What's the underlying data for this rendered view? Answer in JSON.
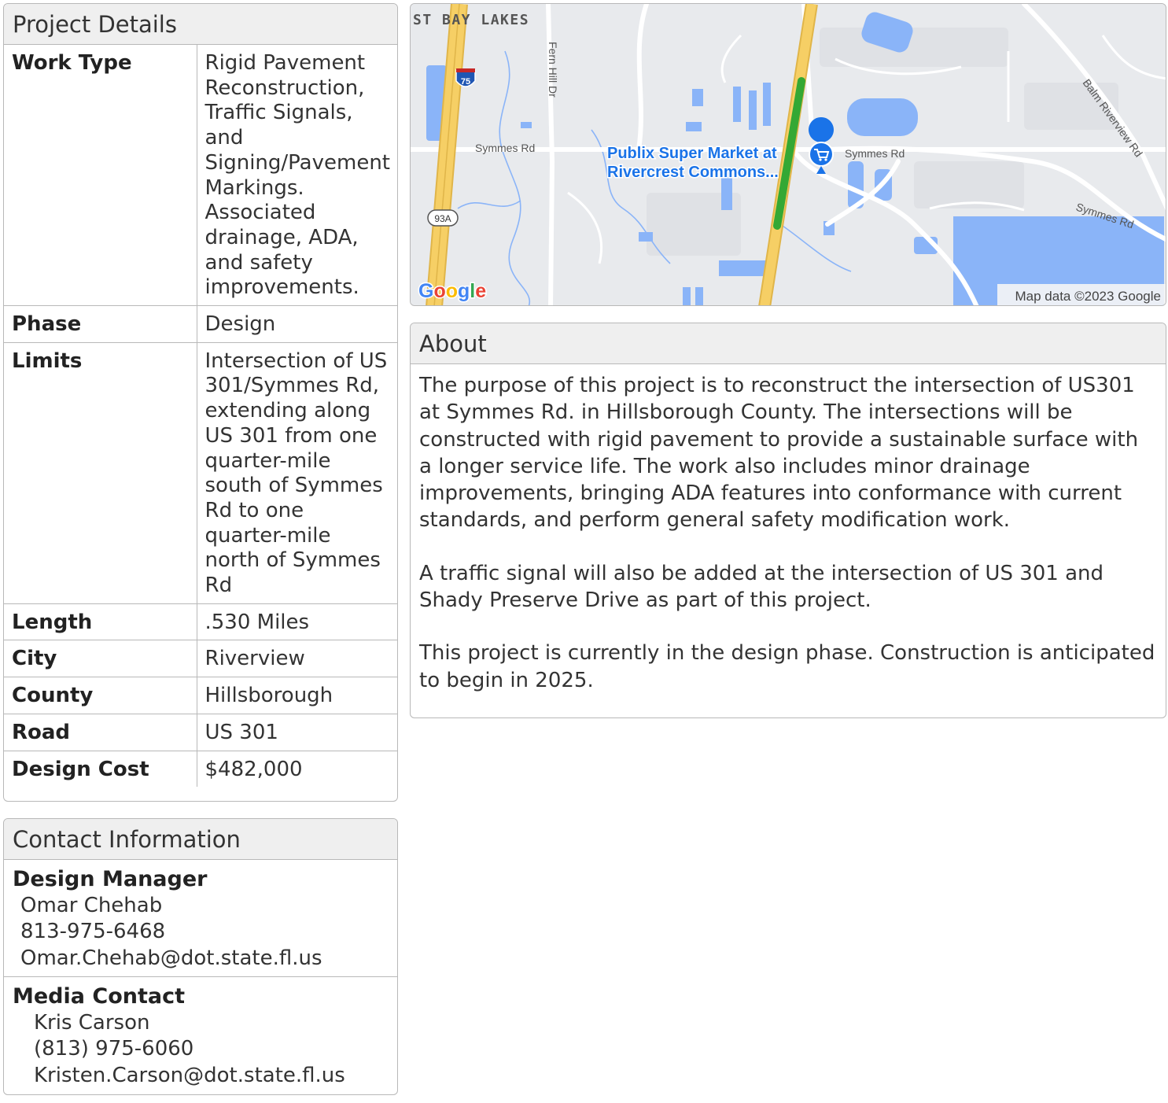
{
  "project_details": {
    "title": "Project Details",
    "rows": [
      {
        "key": "Work Type",
        "value": "Rigid Pavement Reconstruction, Traffic Signals, and Signing/Pavement Markings. Associated drainage, ADA, and safety improvements."
      },
      {
        "key": "Phase",
        "value": "Design"
      },
      {
        "key": "Limits",
        "value": "Intersection of US 301/Symmes Rd, extending along US 301 from one quarter-mile south of Symmes Rd to one quarter-mile north of Symmes Rd"
      },
      {
        "key": "Length",
        "value": ".530 Miles"
      },
      {
        "key": "City",
        "value": "Riverview"
      },
      {
        "key": "County",
        "value": "Hillsborough"
      },
      {
        "key": "Road",
        "value": "US 301"
      },
      {
        "key": "Design Cost",
        "value": "$482,000"
      }
    ]
  },
  "contact": {
    "title": "Contact Information",
    "design_manager": {
      "role": "Design Manager",
      "name": "Omar Chehab",
      "phone": "813-975-6468",
      "email": "Omar.Chehab@dot.state.fl.us"
    },
    "media_contact": {
      "role": "Media Contact",
      "name": "Kris Carson",
      "phone": "(813) 975-6060",
      "email": "Kristen.Carson@dot.state.fl.us"
    }
  },
  "map": {
    "labels": {
      "area": "ST BAY LAKES",
      "road_fern": "Fern Hill Dr",
      "road_symmes_w": "Symmes Rd",
      "road_symmes_e": "Symmes Rd",
      "road_symmes_se": "Symmes Rd",
      "road_balm": "Balm Riverview Rd",
      "poi_line1": "Publix Super Market at",
      "poi_line2": "Rivercrest Commons...",
      "shield_75": "75",
      "shield_93a": "93A",
      "logo": "Google",
      "attribution": "Map data ©2023 Google"
    },
    "icons": {
      "poi": "shopping-cart-icon"
    },
    "colors": {
      "land": "#e8eaed",
      "water": "#8ab4f8",
      "highway": "#f6cf65",
      "project_line": "#34a834",
      "poi_text": "#1a73e8"
    }
  },
  "about": {
    "title": "About",
    "paragraphs": [
      "The purpose of this project is to reconstruct the intersection of US301 at Symmes Rd. in Hillsborough County. The intersections will be constructed with rigid pavement to provide a sustainable surface with a longer service life. The work also includes minor drainage improvements, bringing ADA features into conformance with current standards, and perform general safety modification work.",
      "A traffic signal will also be added at the intersection of US 301 and Shady Preserve Drive as part of this project.",
      "This project is currently in the design phase. Construction is anticipated to begin in 2025."
    ]
  }
}
